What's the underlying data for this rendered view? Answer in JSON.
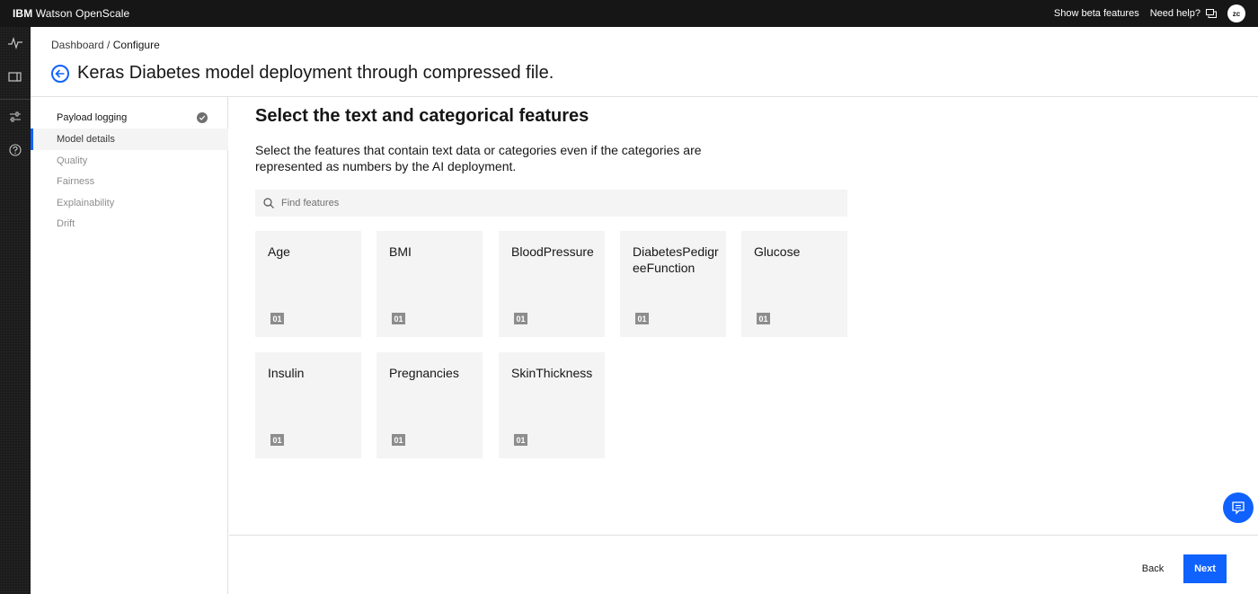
{
  "header": {
    "brand_prefix": "IBM",
    "brand_name": "Watson OpenScale",
    "beta_link": "Show beta features",
    "help_link": "Need help?",
    "avatar_initials": "zc"
  },
  "rail": {
    "icons": [
      "activity-icon",
      "dashboard-icon",
      "configure-sliders-icon",
      "help-icon"
    ]
  },
  "breadcrumb": {
    "parent": "Dashboard",
    "separator": " / ",
    "current": "Configure"
  },
  "page_title": "Keras Diabetes model deployment through compressed file.",
  "nav": {
    "items": [
      {
        "label": "Payload logging",
        "state": "done"
      },
      {
        "label": "Model details",
        "state": "active"
      },
      {
        "label": "Quality",
        "state": "pending"
      },
      {
        "label": "Fairness",
        "state": "pending"
      },
      {
        "label": "Explainability",
        "state": "pending"
      },
      {
        "label": "Drift",
        "state": "pending"
      }
    ]
  },
  "main": {
    "title": "Select the text and categorical features",
    "description": "Select the features that contain text data or categories even if the categories are represented as numbers by the AI deployment.",
    "search_placeholder": "Find features",
    "features": [
      {
        "label": "Age",
        "badge": "01"
      },
      {
        "label": "BMI",
        "badge": "01"
      },
      {
        "label": "BloodPressure",
        "badge": "01"
      },
      {
        "label": "DiabetesPedigreeFunction",
        "badge": "01"
      },
      {
        "label": "Glucose",
        "badge": "01"
      },
      {
        "label": "Insulin",
        "badge": "01"
      },
      {
        "label": "Pregnancies",
        "badge": "01"
      },
      {
        "label": "SkinThickness",
        "badge": "01"
      }
    ]
  },
  "footer": {
    "back_label": "Back",
    "next_label": "Next"
  },
  "colors": {
    "accent": "#0f62fe",
    "header_bg": "#161616",
    "tile_bg": "#f4f4f4"
  }
}
